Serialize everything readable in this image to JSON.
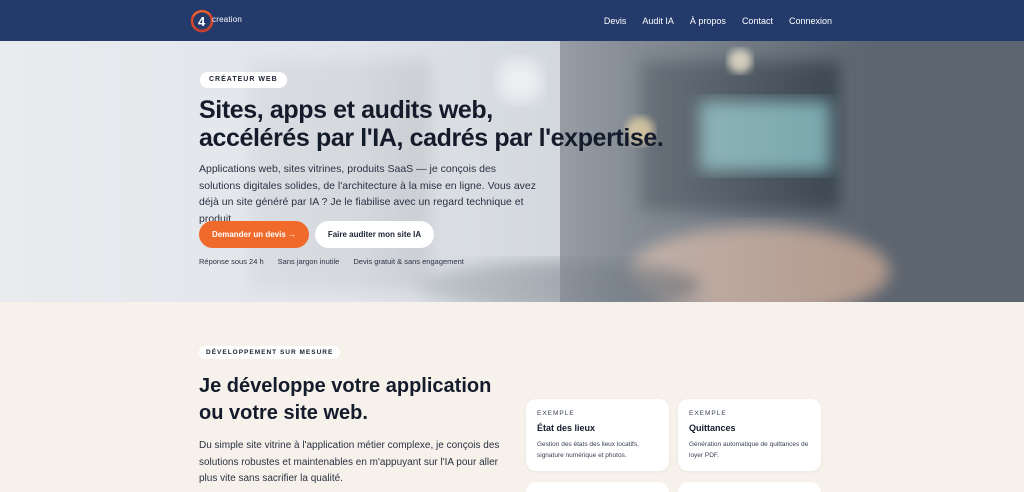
{
  "nav": {
    "logo_text": "creation",
    "links": [
      "Devis",
      "Audit IA",
      "À propos",
      "Contact",
      "Connexion"
    ]
  },
  "hero": {
    "badge": "CRÉATEUR WEB",
    "title_line1": "Sites, apps et audits web,",
    "title_line2": "accélérés par l'IA, cadrés par l'expertise.",
    "subtitle": "Applications web, sites vitrines, produits SaaS — je conçois des solutions digitales solides, de l'architecture à la mise en ligne. Vous avez déjà un site généré par IA ? Je le fiabilise avec un regard technique et produit.",
    "cta_primary": "Demander un devis →",
    "cta_secondary": "Faire auditer mon site IA",
    "assurances": [
      "Réponse sous 24 h",
      "Sans jargon inutile",
      "Devis gratuit & sans engagement"
    ]
  },
  "section": {
    "badge": "DÉVELOPPEMENT SUR MESURE",
    "title_line1": "Je développe votre application",
    "title_line2": "ou votre site web.",
    "text": "Du simple site vitrine à l'application métier complexe, je conçois des solutions robustes et maintenables en m'appuyant sur l'IA pour aller plus vite sans sacrifier la qualité.",
    "cards": [
      {
        "eyebrow": "EXEMPLE",
        "title": "État des lieux",
        "desc": "Gestion des états des lieux locatifs, signature numérique et photos."
      },
      {
        "eyebrow": "EXEMPLE",
        "title": "Quittances",
        "desc": "Génération automatique de quittances de loyer PDF."
      }
    ]
  },
  "colors": {
    "nav_bg": "#243a6b",
    "accent": "#f06a2c",
    "page_bg": "#f6f1ea"
  }
}
